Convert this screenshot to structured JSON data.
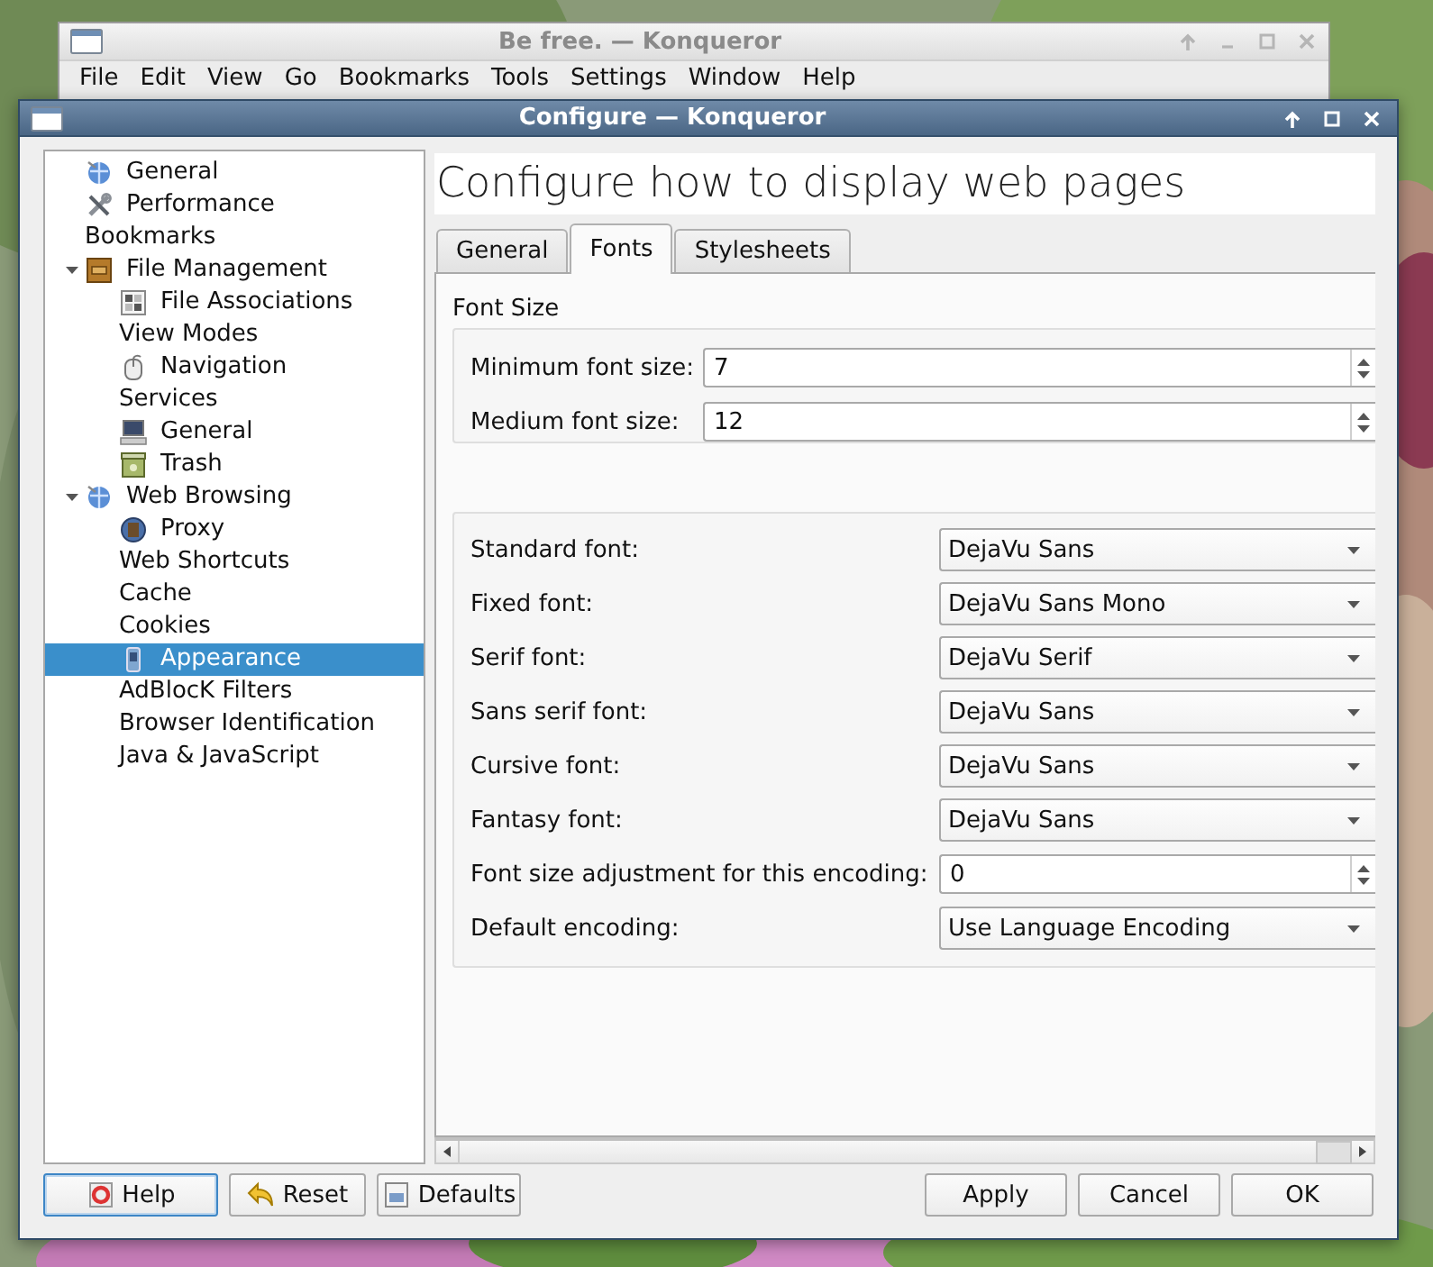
{
  "back_window": {
    "title": "Be free. — Konqueror",
    "menu": [
      "File",
      "Edit",
      "View",
      "Go",
      "Bookmarks",
      "Tools",
      "Settings",
      "Window",
      "Help"
    ]
  },
  "dialog": {
    "title": "Configure — Konqueror",
    "sidebar": {
      "items": [
        {
          "label": "General",
          "kind": "icon",
          "selected": false
        },
        {
          "label": "Performance",
          "kind": "icon",
          "selected": false
        },
        {
          "label": "Bookmarks",
          "kind": "text",
          "selected": false
        },
        {
          "label": "File Management",
          "kind": "icon",
          "selected": false,
          "expanded": true,
          "children": [
            {
              "label": "File Associations",
              "kind": "icon",
              "selected": false
            },
            {
              "label": "View Modes",
              "kind": "text",
              "selected": false
            },
            {
              "label": "Navigation",
              "kind": "icon",
              "selected": false
            },
            {
              "label": "Services",
              "kind": "text",
              "selected": false
            },
            {
              "label": "General",
              "kind": "icon",
              "selected": false
            },
            {
              "label": "Trash",
              "kind": "icon",
              "selected": false
            }
          ]
        },
        {
          "label": "Web Browsing",
          "kind": "icon",
          "selected": false,
          "expanded": true,
          "children": [
            {
              "label": "Proxy",
              "kind": "icon",
              "selected": false
            },
            {
              "label": "Web Shortcuts",
              "kind": "text",
              "selected": false
            },
            {
              "label": "Cache",
              "kind": "text",
              "selected": false
            },
            {
              "label": "Cookies",
              "kind": "text",
              "selected": false
            },
            {
              "label": "Appearance",
              "kind": "icon",
              "selected": true
            },
            {
              "label": "AdBlocK Filters",
              "kind": "text",
              "selected": false
            },
            {
              "label": "Browser Identification",
              "kind": "text",
              "selected": false
            },
            {
              "label": "Java & JavaScript",
              "kind": "text",
              "selected": false
            }
          ]
        }
      ]
    },
    "heading": "Configure how to display web pages",
    "tabs": [
      {
        "label": "General",
        "selected": false
      },
      {
        "label": "Fonts",
        "selected": true
      },
      {
        "label": "Stylesheets",
        "selected": false
      }
    ],
    "font_size": {
      "title": "Font Size",
      "rows": [
        {
          "label": "Minimum font size:",
          "kind": "spin",
          "value": "7"
        },
        {
          "label": "Medium font size:",
          "kind": "spin",
          "value": "12"
        }
      ]
    },
    "fonts": {
      "rows": [
        {
          "label": "Standard font:",
          "kind": "combo",
          "value": "DejaVu Sans"
        },
        {
          "label": "Fixed font:",
          "kind": "combo",
          "value": "DejaVu Sans Mono"
        },
        {
          "label": "Serif font:",
          "kind": "combo",
          "value": "DejaVu Serif"
        },
        {
          "label": "Sans serif font:",
          "kind": "combo",
          "value": "DejaVu Sans"
        },
        {
          "label": "Cursive font:",
          "kind": "combo",
          "value": "DejaVu Sans"
        },
        {
          "label": "Fantasy font:",
          "kind": "combo",
          "value": "DejaVu Sans"
        },
        {
          "label": "Font size adjustment for this encoding:",
          "kind": "spin",
          "value": "0"
        },
        {
          "label": "Default encoding:",
          "kind": "combo",
          "value": "Use Language Encoding"
        }
      ]
    },
    "buttons_left": [
      {
        "label": "Help",
        "focused": true
      },
      {
        "label": "Reset",
        "focused": false
      },
      {
        "label": "Defaults",
        "focused": false
      }
    ],
    "buttons_right": [
      {
        "label": "Apply",
        "focused": false
      },
      {
        "label": "Cancel",
        "focused": false
      },
      {
        "label": "OK",
        "focused": false
      }
    ]
  }
}
